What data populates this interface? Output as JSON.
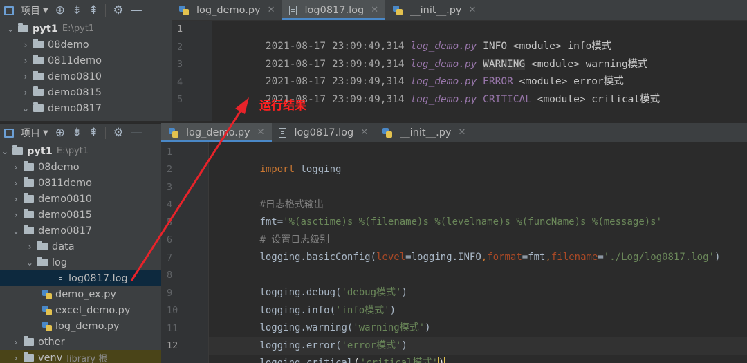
{
  "toolbar": {
    "project_label": "项目"
  },
  "tabs_top": [
    {
      "label": "log_demo.py",
      "kind": "py",
      "active": false
    },
    {
      "label": "log0817.log",
      "kind": "log",
      "active": true
    },
    {
      "label": "__init__.py",
      "kind": "py",
      "active": false
    }
  ],
  "tabs_bottom": [
    {
      "label": "log_demo.py",
      "kind": "py",
      "active": true
    },
    {
      "label": "log0817.log",
      "kind": "log",
      "active": false
    },
    {
      "label": "__init__.py",
      "kind": "py",
      "active": false
    }
  ],
  "tree_top": {
    "root": {
      "name": "pyt1",
      "path": "E:\\pyt1"
    },
    "items": [
      "08demo",
      "0811demo",
      "demo0810",
      "demo0815",
      "demo0817"
    ]
  },
  "tree_bottom": {
    "root": {
      "name": "pyt1",
      "path": "E:\\pyt1"
    },
    "items": [
      "08demo",
      "0811demo",
      "demo0810",
      "demo0815",
      "demo0817"
    ],
    "sub": [
      "data",
      "log"
    ],
    "selected_file": "log0817.log",
    "files": [
      "demo_ex.py",
      "excel_demo.py",
      "log_demo.py"
    ],
    "other": "other",
    "venv": "venv",
    "venv_note": "library 根"
  },
  "log_lines": {
    "line_numbers": [
      "1",
      "2",
      "3",
      "4",
      "5"
    ],
    "lines": [
      {
        "ts": "2021-08-17 23:09:49,314",
        "file": "log_demo.py",
        "level": "INFO",
        "module": "<module>",
        "msg": "info模式"
      },
      {
        "ts": "2021-08-17 23:09:49,314",
        "file": "log_demo.py",
        "level": "WARNING",
        "module": "<module>",
        "msg": "warning模式"
      },
      {
        "ts": "2021-08-17 23:09:49,314",
        "file": "log_demo.py",
        "level": "ERROR",
        "module": "<module>",
        "msg": "error模式"
      },
      {
        "ts": "2021-08-17 23:09:49,314",
        "file": "log_demo.py",
        "level": "CRITICAL",
        "module": "<module>",
        "msg": "critical模式"
      }
    ]
  },
  "code": {
    "line_numbers": [
      "1",
      "2",
      "3",
      "4",
      "5",
      "6",
      "7",
      "8",
      "9",
      "10",
      "11",
      "12"
    ],
    "import_kw": "import",
    "import_mod": " logging",
    "comment1": "#日志格式输出",
    "fmt_var": "fmt",
    "fmt_eq": "=",
    "fmt_str": "'%(asctime)s %(filename)s %(levelname)s %(funcName)s %(message)s'",
    "comment2": "# 设置日志级别",
    "basic_pre": "logging.basicConfig(",
    "p_level": "level",
    "v_level": "=logging.INFO",
    "comma1": ",",
    "p_format": "format",
    "v_format": "=fmt",
    "comma2": ",",
    "p_filename": "filename",
    "eq3": "=",
    "v_filename": "'./Log/log0817.log'",
    "basic_close": ")",
    "calls": [
      {
        "fn": "logging.debug(",
        "arg": "'debug模式'",
        "close": ")"
      },
      {
        "fn": "logging.info(",
        "arg": "'info模式'",
        "close": ")"
      },
      {
        "fn": "logging.warning(",
        "arg": "'warning模式'",
        "close": ")"
      },
      {
        "fn": "logging.error(",
        "arg": "'error模式'",
        "close": ")"
      }
    ],
    "last_fn": "logging.critical",
    "last_open": "(",
    "last_arg": "'critical模式'",
    "last_close": ")"
  },
  "annotation": {
    "text": "运行结果",
    "color": "#ff2020"
  },
  "colors": {
    "keyword": "#cc7832",
    "string": "#6a8759",
    "param": "#aa4926",
    "filename_italic": "#9876aa"
  },
  "icons": [
    "folder-icon",
    "python-file-icon",
    "log-file-icon",
    "crosshair-icon",
    "expand-all-icon",
    "collapse-all-icon",
    "gear-icon",
    "minimize-icon"
  ]
}
